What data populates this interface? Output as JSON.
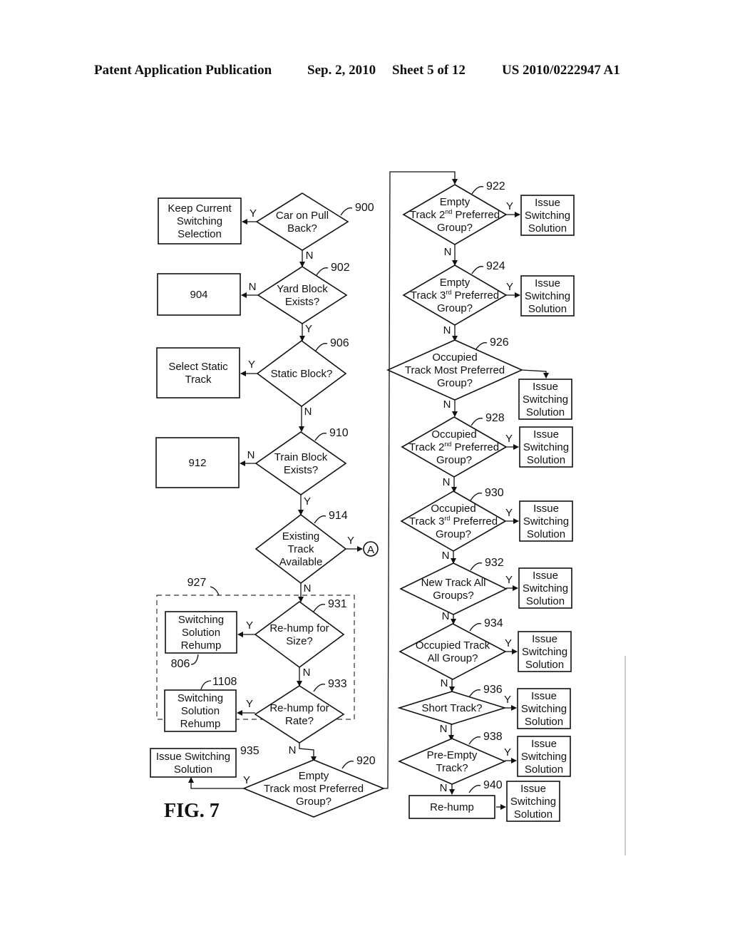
{
  "header": {
    "publication": "Patent Application Publication",
    "date": "Sep. 2, 2010",
    "sheet": "Sheet 5 of 12",
    "number": "US 2010/0222947 A1"
  },
  "figure": {
    "label": "FIG. 7",
    "group_ref": "927",
    "connector": "A"
  },
  "decisions": {
    "d900": {
      "ref": "900",
      "lines": [
        "Car on Pull",
        "Back?"
      ],
      "yes": "Y",
      "no": "N"
    },
    "d902": {
      "ref": "902",
      "lines": [
        "Yard Block",
        "Exists?"
      ],
      "yes": "Y",
      "no": "N"
    },
    "d906": {
      "ref": "906",
      "lines": [
        "Static Block?"
      ],
      "yes": "Y",
      "no": "N"
    },
    "d910": {
      "ref": "910",
      "lines": [
        "Train Block",
        "Exists?"
      ],
      "yes": "Y",
      "no": "N"
    },
    "d914": {
      "ref": "914",
      "lines": [
        "Existing",
        "Track",
        "Available"
      ],
      "yes": "Y",
      "no": "N"
    },
    "d931": {
      "ref": "931",
      "lines": [
        "Re-hump for",
        "Size?"
      ],
      "yes": "Y",
      "no": "N"
    },
    "d933": {
      "ref": "933",
      "lines": [
        "Re-hump for",
        "Rate?"
      ],
      "yes": "Y",
      "no": "N"
    },
    "d920": {
      "ref": "920",
      "lines": [
        "Empty",
        "Track most Preferred",
        "Group?"
      ],
      "yes": "Y"
    },
    "d922": {
      "ref": "922",
      "lines": [
        "Empty",
        "Track 2nd Preferred",
        "Group?"
      ],
      "yes": "Y",
      "no": "N"
    },
    "d924": {
      "ref": "924",
      "lines": [
        "Empty",
        "Track 3rd Preferred",
        "Group?"
      ],
      "yes": "Y",
      "no": "N"
    },
    "d926": {
      "ref": "926",
      "lines": [
        "Occupied",
        "Track Most Preferred",
        "Group?"
      ],
      "no": "N"
    },
    "d928": {
      "ref": "928",
      "lines": [
        "Occupied",
        "Track 2nd Preferred",
        "Group?"
      ],
      "yes": "Y",
      "no": "N"
    },
    "d930": {
      "ref": "930",
      "lines": [
        "Occupied",
        "Track 3rd Preferred",
        "Group?"
      ],
      "yes": "Y",
      "no": "N"
    },
    "d932": {
      "ref": "932",
      "lines": [
        "New Track All",
        "Groups?"
      ],
      "yes": "Y",
      "no": "N"
    },
    "d934": {
      "ref": "934",
      "lines": [
        "Occupied Track",
        "All Group?"
      ],
      "yes": "Y",
      "no": "N"
    },
    "d936": {
      "ref": "936",
      "lines": [
        "Short Track?"
      ],
      "yes": "Y",
      "no": "N"
    },
    "d938": {
      "ref": "938",
      "lines": [
        "Pre-Empty",
        "Track?"
      ],
      "yes": "Y",
      "no": "N"
    }
  },
  "boxes": {
    "keep_current": {
      "lines": [
        "Keep Current",
        "Switching",
        "Selection"
      ]
    },
    "b904": {
      "lines": [
        "904"
      ]
    },
    "select_static": {
      "lines": [
        "Select Static",
        "Track"
      ]
    },
    "b912": {
      "lines": [
        "912"
      ]
    },
    "rehump_806": {
      "ref": "806",
      "lines": [
        "Switching",
        "Solution",
        "Rehump"
      ]
    },
    "rehump_1108": {
      "ref": "1108",
      "lines": [
        "Switching",
        "Solution",
        "Rehump"
      ]
    },
    "issue_935": {
      "ref": "935",
      "lines": [
        "Issue Switching",
        "Solution"
      ]
    },
    "rehump_940": {
      "ref": "940",
      "lines": [
        "Re-hump"
      ]
    },
    "issue": {
      "lines": [
        "Issue",
        "Switching",
        "Solution"
      ]
    }
  }
}
